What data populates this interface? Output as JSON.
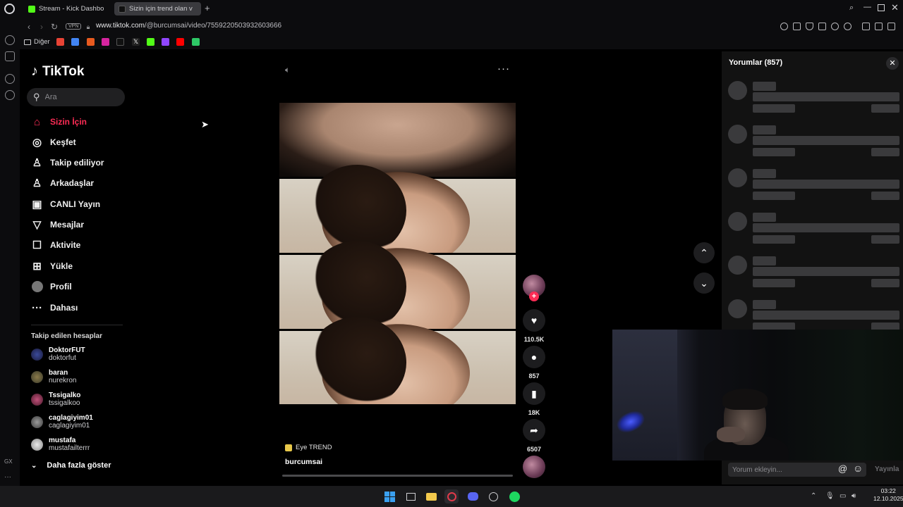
{
  "browser": {
    "tabs": [
      {
        "label": "Stream - Kick Dashbo",
        "favicon": "kick-logo-icon"
      },
      {
        "label": "Sizin için trend olan v",
        "favicon": "tiktok-logo-icon"
      }
    ],
    "url_host": "www.tiktok.com",
    "url_path": "/@burcumsai/video/7559220503932603666",
    "vpn_label": "VPN",
    "bookmarks_folder": "Diğer",
    "gx_label": "GX"
  },
  "sidebar": {
    "logo_text": "TikTok",
    "search_placeholder": "Ara",
    "nav": [
      {
        "label": "Sizin İçin",
        "icon": "home-icon"
      },
      {
        "label": "Keşfet",
        "icon": "compass-icon"
      },
      {
        "label": "Takip ediliyor",
        "icon": "following-icon"
      },
      {
        "label": "Arkadaşlar",
        "icon": "friends-icon"
      },
      {
        "label": "CANLI Yayın",
        "icon": "live-icon"
      },
      {
        "label": "Mesajlar",
        "icon": "messages-icon"
      },
      {
        "label": "Aktivite",
        "icon": "activity-icon"
      },
      {
        "label": "Yükle",
        "icon": "upload-icon"
      },
      {
        "label": "Profil",
        "icon": "profile-icon"
      },
      {
        "label": "Dahası",
        "icon": "more-icon"
      }
    ],
    "following_header": "Takip edilen hesaplar",
    "accounts": [
      {
        "name": "DoktorFUT",
        "username": "doktorfut"
      },
      {
        "name": "baran",
        "username": "nurekron"
      },
      {
        "name": "Tssigalko",
        "username": "tssigalkoo"
      },
      {
        "name": "caglagiyim01",
        "username": "caglagiyim01"
      },
      {
        "name": "mustafa",
        "username": "mustafailterrr"
      }
    ],
    "more_accounts": "Daha fazla göster"
  },
  "video": {
    "sound_tag": "Eye TREND",
    "author": "burcumsai",
    "likes": "110.5K",
    "comments": "857",
    "saves": "18K",
    "shares": "6507"
  },
  "comments": {
    "title": "Yorumlar (857)",
    "input_placeholder": "Yorum ekleyin...",
    "post_label": "Yayınla"
  },
  "taskbar": {
    "time": "03:22",
    "date": "12.10.2025"
  },
  "colors": {
    "accent": "#fe2c55",
    "background": "#000000",
    "panel": "#121212"
  }
}
